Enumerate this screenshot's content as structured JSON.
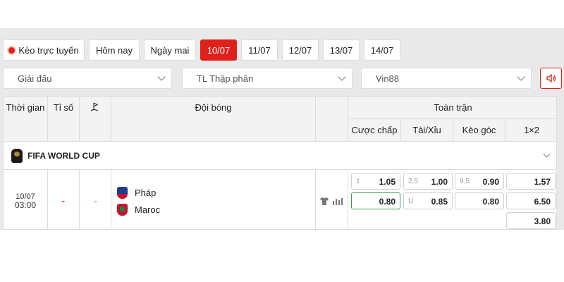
{
  "dates": {
    "live_label": "Kèo trực tuyến",
    "today": "Hôm nay",
    "tomorrow": "Ngày mai",
    "days": [
      "10/07",
      "11/07",
      "12/07",
      "13/07",
      "14/07"
    ],
    "active_day": "10/07",
    "live_dot_color": "#e0201b"
  },
  "filters": {
    "league_select": "Giải đấu",
    "odds_format_select": "TL Thập phân",
    "bookmaker_select": "Vin88",
    "sound_icon": "speaker-icon"
  },
  "table": {
    "headers": {
      "time": "Thời gian",
      "score": "Tỉ số",
      "corner_icon": "corner-flag-icon",
      "teams": "Đội bóng",
      "full_match": "Toàn trận",
      "handicap": "Cược chấp",
      "over_under": "Tài/Xỉu",
      "corners": "Kèo góc",
      "one_x_two": "1×2"
    },
    "league": {
      "name": "FIFA WORLD CUP",
      "logo_icon": "world-cup-trophy-icon"
    },
    "match": {
      "date": "10/07",
      "time": "03:00",
      "score": "-",
      "corner_score": "-",
      "home_team": "Pháp",
      "away_team": "Maroc",
      "jersey_icon": "jersey-icon",
      "stats_icon": "stats-icon",
      "handicap": {
        "line": "1",
        "home": "1.05",
        "away": "0.80"
      },
      "over_under": {
        "line": "2.5",
        "over": "1.00",
        "under_label": "U",
        "under": "0.85"
      },
      "corners": {
        "line": "9.5",
        "over": "0.90",
        "under": "0.80"
      },
      "one_x_two": {
        "home": "1.57",
        "away": "6.50",
        "draw": "3.80"
      }
    }
  },
  "colors": {
    "accent": "#e0201b",
    "odds_border_active": "#3a9a47"
  }
}
